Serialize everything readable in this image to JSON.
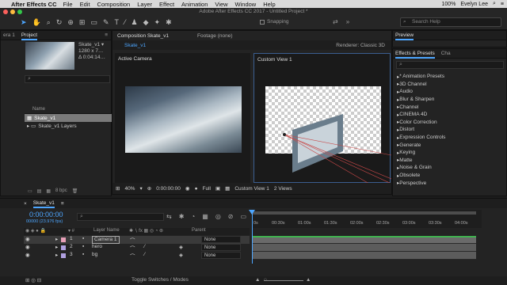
{
  "menubar": {
    "app": "After Effects CC",
    "items": [
      "File",
      "Edit",
      "Composition",
      "Layer",
      "Effect",
      "Animation",
      "View",
      "Window",
      "Help"
    ],
    "battery": "100%",
    "user": "Evelyn Lee"
  },
  "window": {
    "title": "Adobe After Effects CC 2017 - Untitled Project *"
  },
  "toolbar": {
    "snapping": "Snapping",
    "search_placeholder": "Search Help"
  },
  "project": {
    "tabs": [
      "era 1",
      "Project"
    ],
    "comp_name": "Skate_v1 ▾",
    "comp_dims": "1280 x 7…",
    "comp_duration": "Δ 0:04:14…",
    "col_name": "Name",
    "items": [
      {
        "name": "Skate_v1",
        "selected": true
      },
      {
        "name": "Skate_v1 Layers",
        "selected": false
      }
    ],
    "bpc": "8 bpc"
  },
  "composition": {
    "tab": "Composition Skate_v1",
    "footage": "Footage (none)",
    "subtab": "Skate_v1",
    "renderer": "Renderer:",
    "renderer_value": "Classic 3D",
    "view1": "Active Camera",
    "view2": "Custom View 1",
    "zoom": "40%",
    "timecode": "0:00:00:00",
    "quality": "Full",
    "view_select": "Custom View 1",
    "views": "2 Views"
  },
  "preview": {
    "tab": "Preview"
  },
  "effects": {
    "tabs": [
      "Effects & Presets",
      "Cha"
    ],
    "items": [
      "* Animation Presets",
      "3D Channel",
      "Audio",
      "Blur & Sharpen",
      "Channel",
      "CINEMA 4D",
      "Color Correction",
      "Distort",
      "Expression Controls",
      "Generate",
      "Keying",
      "Matte",
      "Noise & Grain",
      "Obsolete",
      "Perspective"
    ]
  },
  "timeline": {
    "tab": "Skate_v1",
    "timecode": "0:00:00:00",
    "fps": "00000 (23.976 fps)",
    "col_layer_name": "Layer Name",
    "col_parent": "Parent",
    "ticks": [
      "0s",
      "00:30s",
      "01:00s",
      "01:30s",
      "02:00s",
      "02:30s",
      "03:00s",
      "03:30s",
      "04:00s"
    ],
    "layers": [
      {
        "num": "1",
        "name": "Camera 1",
        "parent": "None",
        "color": "#e8a0b8"
      },
      {
        "num": "2",
        "name": "hero",
        "parent": "None",
        "color": "#b0a0e0"
      },
      {
        "num": "3",
        "name": "bg",
        "parent": "None",
        "color": "#b0a0e0"
      }
    ],
    "toggle": "Toggle Switches / Modes"
  }
}
